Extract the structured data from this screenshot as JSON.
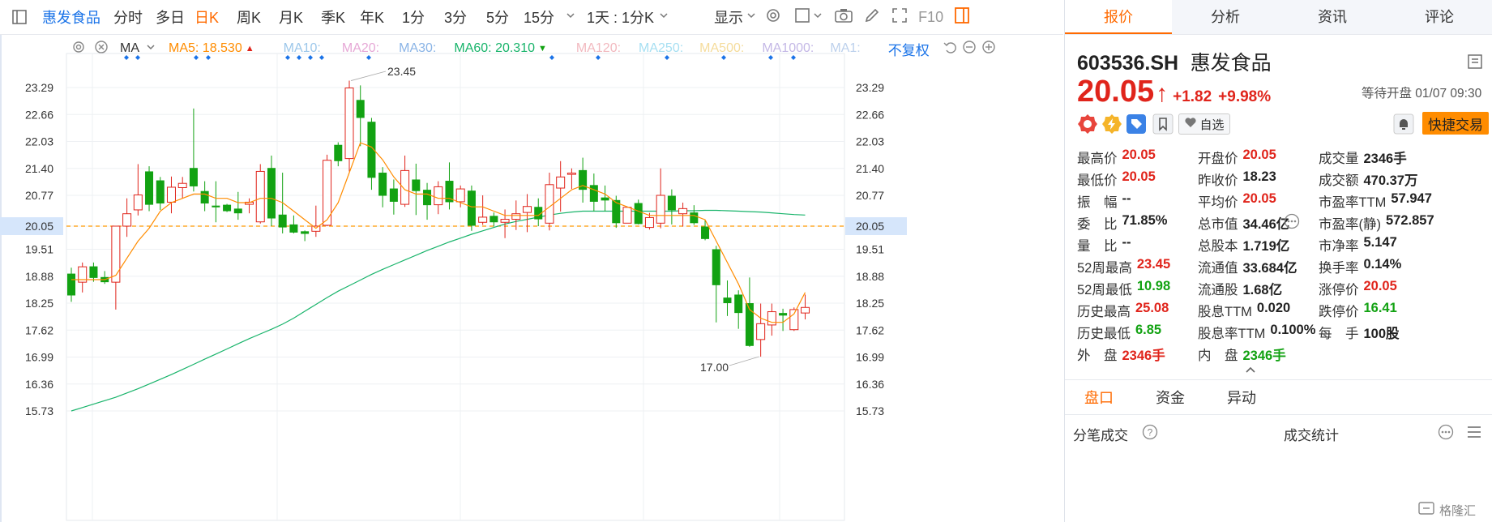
{
  "toolbar": {
    "stock_name": "惠发食品",
    "periods": [
      "分时",
      "多日",
      "日K",
      "周K",
      "月K",
      "季K",
      "年K",
      "1分",
      "3分",
      "5分",
      "15分"
    ],
    "active_period": "日K",
    "combo_label": "1天 : 1分K",
    "display_label": "显示",
    "f10_label": "F10"
  },
  "indicator_bar": {
    "ma_label": "MA",
    "ma5": "MA5: 18.530",
    "ma10": "MA10:",
    "ma20": "MA20:",
    "ma30": "MA30:",
    "ma60": "MA60: 20.310",
    "ma120": "MA120:",
    "ma250": "MA250:",
    "ma500": "MA500:",
    "ma1000": "MA1000:",
    "ma_more": "MA1:",
    "adjust": "不复权"
  },
  "colors": {
    "accent": "#ff6a00",
    "up": "#e0241b",
    "down": "#12a212",
    "blue": "#1a73e8",
    "ma5": "#ff8c00",
    "ma60": "#19b46b"
  },
  "chart_data": {
    "type": "candlestick",
    "y_ticks": [
      "23.29",
      "22.66",
      "22.03",
      "21.40",
      "20.77",
      "20.05",
      "19.51",
      "18.88",
      "18.25",
      "17.62",
      "16.99",
      "16.36",
      "15.73"
    ],
    "high_marker": "23.45",
    "low_marker": "17.00",
    "current_price": "20.05",
    "candles": [
      [
        18.94,
        18.43,
        19.08,
        18.28
      ],
      [
        18.74,
        19.1,
        19.2,
        18.5
      ],
      [
        19.11,
        18.84,
        19.2,
        18.75
      ],
      [
        18.86,
        18.74,
        19.0,
        18.7
      ],
      [
        18.74,
        20.05,
        20.05,
        18.1
      ],
      [
        20.05,
        20.34,
        20.7,
        19.8
      ],
      [
        20.43,
        20.78,
        21.5,
        20.3
      ],
      [
        21.33,
        20.55,
        21.45,
        20.4
      ],
      [
        21.12,
        20.58,
        21.2,
        20.43
      ],
      [
        20.61,
        20.96,
        21.21,
        20.35
      ],
      [
        20.95,
        21.05,
        21.2,
        20.7
      ],
      [
        21.41,
        20.98,
        22.8,
        20.86
      ],
      [
        20.87,
        20.58,
        21.1,
        20.4
      ],
      [
        20.53,
        20.49,
        21.1,
        20.14
      ],
      [
        20.55,
        20.4,
        20.57,
        20.38
      ],
      [
        20.46,
        20.35,
        20.85,
        20.2
      ],
      [
        20.56,
        20.61,
        20.7,
        20.35
      ],
      [
        20.15,
        21.33,
        21.5,
        20.11
      ],
      [
        21.41,
        20.23,
        21.7,
        20.05
      ],
      [
        20.32,
        20.02,
        21.3,
        19.88
      ],
      [
        20.09,
        19.9,
        20.3,
        19.88
      ],
      [
        19.93,
        19.87,
        19.95,
        19.7
      ],
      [
        19.93,
        20.05,
        20.53,
        19.8
      ],
      [
        20.07,
        21.59,
        21.72,
        20.05
      ],
      [
        21.95,
        21.57,
        22.01,
        21.45
      ],
      [
        21.63,
        23.28,
        23.45,
        21.33
      ],
      [
        23.0,
        22.58,
        23.34,
        21.92
      ],
      [
        22.49,
        21.18,
        22.58,
        20.9
      ],
      [
        21.3,
        20.76,
        21.43,
        20.49
      ],
      [
        20.93,
        20.62,
        21.14,
        20.32
      ],
      [
        20.56,
        21.35,
        21.7,
        20.5
      ],
      [
        21.14,
        20.87,
        21.51,
        20.31
      ],
      [
        20.9,
        20.54,
        21.06,
        20.2
      ],
      [
        20.55,
        20.97,
        21.1,
        20.33
      ],
      [
        21.11,
        20.61,
        21.54,
        20.44
      ],
      [
        20.62,
        20.92,
        21.0,
        20.49
      ],
      [
        20.88,
        20.06,
        21.0,
        19.94
      ],
      [
        20.14,
        20.26,
        20.77,
        20.08
      ],
      [
        20.29,
        20.14,
        20.37,
        20.04
      ],
      [
        20.14,
        20.21,
        20.44,
        19.77
      ],
      [
        20.21,
        20.34,
        20.65,
        19.96
      ],
      [
        20.37,
        20.51,
        20.8,
        19.91
      ],
      [
        20.5,
        20.21,
        20.7,
        20.05
      ],
      [
        20.12,
        21.02,
        21.3,
        19.95
      ],
      [
        20.94,
        21.2,
        21.57,
        20.39
      ],
      [
        21.26,
        21.29,
        21.4,
        20.92
      ],
      [
        21.36,
        20.9,
        21.65,
        20.6
      ],
      [
        21.01,
        20.62,
        21.28,
        20.4
      ],
      [
        20.72,
        20.65,
        21.0,
        20.4
      ],
      [
        20.66,
        20.12,
        20.76,
        20.01
      ],
      [
        20.12,
        20.49,
        20.5,
        20.18
      ],
      [
        20.59,
        20.1,
        20.67,
        20.09
      ],
      [
        20.02,
        20.25,
        20.36,
        19.97
      ],
      [
        20.12,
        20.77,
        21.4,
        20.0
      ],
      [
        20.76,
        20.42,
        20.91,
        20.09
      ],
      [
        20.34,
        20.46,
        20.6,
        20.04
      ],
      [
        20.37,
        20.12,
        20.54,
        20.08
      ],
      [
        20.04,
        19.75,
        20.2,
        19.72
      ],
      [
        19.51,
        18.67,
        19.59,
        17.8
      ],
      [
        18.38,
        18.25,
        18.78,
        17.95
      ],
      [
        18.45,
        18.02,
        18.55,
        17.65
      ],
      [
        18.25,
        17.25,
        18.85,
        17.23
      ],
      [
        17.4,
        17.77,
        18.24,
        17.0
      ],
      [
        17.74,
        18.05,
        18.24,
        17.49
      ],
      [
        18.02,
        17.96,
        18.12,
        17.6
      ],
      [
        17.63,
        18.1,
        18.15,
        17.6
      ],
      [
        18.02,
        18.15,
        18.45,
        17.87
      ]
    ],
    "ma5_values": [
      18.8,
      18.8,
      18.8,
      18.8,
      18.9,
      19.3,
      19.7,
      20.0,
      20.4,
      20.6,
      20.7,
      20.8,
      20.8,
      20.7,
      20.7,
      20.6,
      20.6,
      20.7,
      20.7,
      20.6,
      20.4,
      20.2,
      20.0,
      20.2,
      20.6,
      21.3,
      22.0,
      21.9,
      21.6,
      21.2,
      20.9,
      20.8,
      20.8,
      20.7,
      20.7,
      20.6,
      20.5,
      20.5,
      20.4,
      20.3,
      20.3,
      20.3,
      20.3,
      20.5,
      20.7,
      20.9,
      21.0,
      20.9,
      20.8,
      20.6,
      20.5,
      20.4,
      20.3,
      20.3,
      20.3,
      20.3,
      20.3,
      20.2,
      19.7,
      19.2,
      18.7,
      18.1,
      17.9,
      17.8,
      17.8,
      18.0,
      18.5
    ],
    "ma60_values": [
      15.73,
      15.81,
      15.89,
      15.97,
      16.05,
      16.15,
      16.25,
      16.36,
      16.47,
      16.58,
      16.7,
      16.82,
      16.94,
      17.06,
      17.18,
      17.3,
      17.42,
      17.53,
      17.64,
      17.76,
      17.9,
      18.06,
      18.22,
      18.38,
      18.53,
      18.66,
      18.79,
      18.92,
      19.04,
      19.15,
      19.26,
      19.37,
      19.48,
      19.58,
      19.68,
      19.77,
      19.86,
      19.94,
      20.02,
      20.1,
      20.16,
      20.21,
      20.26,
      20.31,
      20.35,
      20.38,
      20.4,
      20.4,
      20.4,
      20.4,
      20.4,
      20.4,
      20.4,
      20.4,
      20.4,
      20.41,
      20.41,
      20.42,
      20.42,
      20.41,
      20.4,
      20.39,
      20.38,
      20.36,
      20.34,
      20.32,
      20.31
    ]
  },
  "panel": {
    "tabs": [
      "报价",
      "分析",
      "资讯",
      "评论"
    ],
    "active_tab": "报价",
    "code": "603536.SH",
    "name": "惠发食品",
    "price": "20.05",
    "arrow": "↑",
    "change": "+1.82",
    "change_pct": "+9.98%",
    "status": "等待开盘 01/07 09:30",
    "watch_label": "自选",
    "trade_label": "快捷交易",
    "quote": [
      [
        [
          "最高价",
          "20.05",
          "red"
        ],
        [
          "开盘价",
          "20.05",
          "red"
        ],
        [
          "成交量",
          "2346手",
          "dark"
        ]
      ],
      [
        [
          "最低价",
          "20.05",
          "red"
        ],
        [
          "昨收价",
          "18.23",
          "dark"
        ],
        [
          "成交额",
          "470.37万",
          "dark"
        ]
      ],
      [
        [
          "振　幅",
          "--",
          "dark"
        ],
        [
          "平均价",
          "20.05",
          "red"
        ],
        [
          "市盈率TTM",
          "57.947",
          "dark"
        ]
      ],
      [
        [
          "委　比",
          "71.85%",
          "dark"
        ],
        [
          "总市值",
          "34.46亿",
          "dark"
        ],
        [
          "市盈率(静)",
          "572.857",
          "dark"
        ]
      ],
      [
        [
          "量　比",
          "--",
          "dark"
        ],
        [
          "总股本",
          "1.719亿",
          "dark"
        ],
        [
          "市净率",
          "5.147",
          "dark"
        ]
      ],
      [
        [
          "52周最高",
          "23.45",
          "red"
        ],
        [
          "流通值",
          "33.684亿",
          "dark"
        ],
        [
          "换手率",
          "0.14%",
          "dark"
        ]
      ],
      [
        [
          "52周最低",
          "10.98",
          "green"
        ],
        [
          "流通股",
          "1.68亿",
          "dark"
        ],
        [
          "涨停价",
          "20.05",
          "red"
        ]
      ],
      [
        [
          "历史最高",
          "25.08",
          "red"
        ],
        [
          "股息TTM",
          "0.020",
          "dark"
        ],
        [
          "跌停价",
          "16.41",
          "green"
        ]
      ],
      [
        [
          "历史最低",
          "6.85",
          "green"
        ],
        [
          "股息率TTM",
          "0.100%",
          "dark"
        ],
        [
          "每　手",
          "100股",
          "dark"
        ]
      ],
      [
        [
          "外　盘",
          "2346手",
          "red"
        ],
        [
          "内　盘",
          "2346手",
          "green"
        ],
        [
          "",
          "",
          " dark"
        ]
      ]
    ],
    "sub_tabs": [
      "盘口",
      "资金",
      "异动"
    ],
    "active_sub": "盘口",
    "ticks_label": "分笔成交",
    "stats_label": "成交统计",
    "watermark": "格隆汇"
  }
}
